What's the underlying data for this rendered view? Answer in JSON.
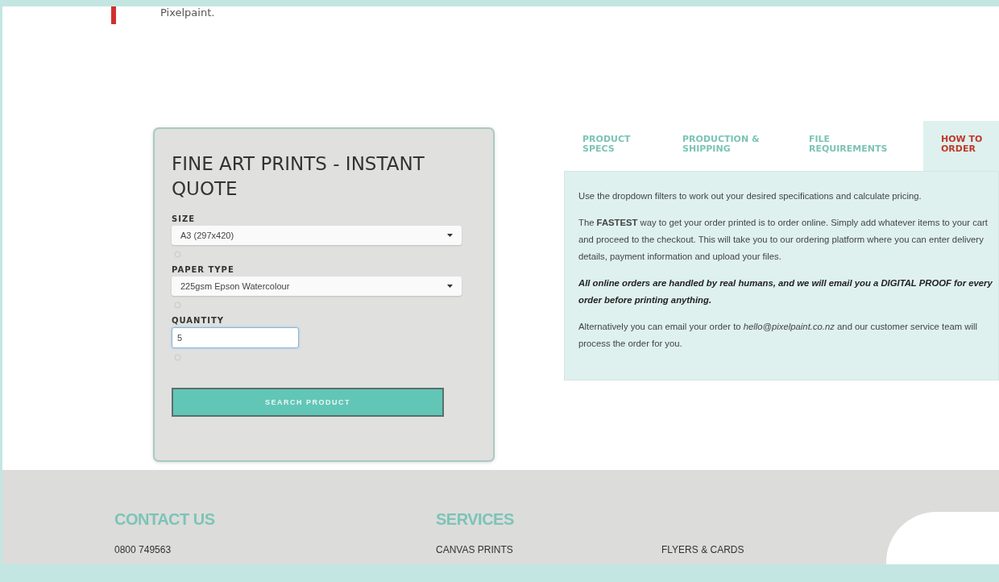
{
  "intro": {
    "text": "Pixelpaint."
  },
  "quote_form": {
    "title": "FINE ART PRINTS - INSTANT QUOTE",
    "fields": [
      {
        "kind": "select",
        "label": "SIZE",
        "value": "A3 (297x420)"
      },
      {
        "kind": "select",
        "label": "PAPER TYPE",
        "value": "225gsm Epson Watercolour"
      },
      {
        "kind": "input",
        "label": "QUANTITY",
        "value": "5"
      }
    ],
    "button": "SEARCH PRODUCT"
  },
  "tabs": [
    {
      "label": "PRODUCT SPECS",
      "selected": false
    },
    {
      "label": "PRODUCTION & SHIPPING",
      "selected": false
    },
    {
      "label": "FILE REQUIREMENTS",
      "selected": false
    },
    {
      "label": "HOW TO ORDER",
      "selected": true
    }
  ],
  "tab_panel": {
    "paragraphs": [
      {
        "kind": "plain",
        "text": "Use the dropdown filters to work out your desired specifications and calculate pricing."
      },
      {
        "kind": "plain",
        "text": "The **FASTEST** way to get your order printed is to order online. Simply add whatever items to your cart and proceed to the checkout. This will take you to our ordering platform where you can enter delivery details, payment information and upload your files."
      },
      {
        "kind": "emphasis",
        "text": "All online orders are handled by real humans, and we will email you a DIGITAL PROOF for every order before printing anything."
      },
      {
        "kind": "plain",
        "text": "Alternatively you can email your order to *hello@pixelpaint.co.nz* and our customer service team will process the order for you."
      }
    ]
  },
  "footer": {
    "columns": [
      {
        "heading": "CONTACT US",
        "items": [
          "0800 749563"
        ]
      },
      {
        "heading": "SERVICES",
        "items": [
          "CANVAS PRINTS"
        ]
      },
      {
        "items": [
          "FLYERS & CARDS"
        ]
      }
    ]
  }
}
